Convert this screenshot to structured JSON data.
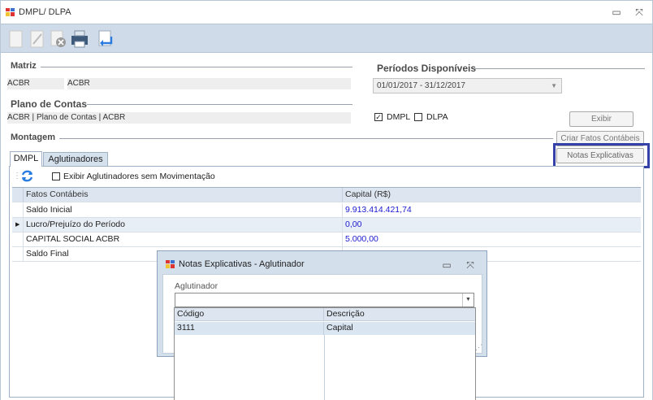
{
  "window": {
    "title": "DMPL/ DLPA",
    "minimize": "▭",
    "close": "⤧"
  },
  "toolbar": {
    "tools": [
      "new-icon",
      "edit-icon",
      "cancel-icon",
      "print-icon",
      "return-icon"
    ]
  },
  "matriz": {
    "label": "Matriz",
    "code": "ACBR",
    "name": "ACBR"
  },
  "periodos": {
    "label": "Períodos Disponíveis",
    "selected": "01/01/2017 - 31/12/2017"
  },
  "plano": {
    "label": "Plano de Contas",
    "value": "ACBR | Plano de Contas | ACBR"
  },
  "options": {
    "dmpl_label": "DMPL",
    "dmpl_checked": "✓",
    "dlpa_label": "DLPA"
  },
  "buttons": {
    "exibir": "Exibir",
    "criar": "Criar Fatos Contábeis",
    "notas": "Notas Explicativas"
  },
  "montagem": {
    "label": "Montagem",
    "tabs": [
      "DMPL",
      "Aglutinadores"
    ],
    "show_aglutinadores_label": "Exibir Aglutinadores sem Movimentação"
  },
  "grid": {
    "columns": [
      "Fatos Contábeis",
      "Capital (R$)"
    ],
    "rows": [
      {
        "fato": "Saldo Inicial",
        "capital": "9.913.414.421,74"
      },
      {
        "fato": "Lucro/Prejuízo do Período",
        "capital": "0,00"
      },
      {
        "fato": "CAPITAL SOCIAL ACBR",
        "capital": "5.000,00"
      },
      {
        "fato": "Saldo Final",
        "capital": ""
      }
    ]
  },
  "dialog": {
    "title": "Notas Explicativas - Aglutinador",
    "field_label": "Aglutinador",
    "field_value": "",
    "minimize": "▭",
    "close": "⤧"
  },
  "popup": {
    "columns": [
      "Código",
      "Descrição"
    ],
    "rows": [
      {
        "codigo": "3111",
        "descricao": "Capital"
      }
    ]
  }
}
